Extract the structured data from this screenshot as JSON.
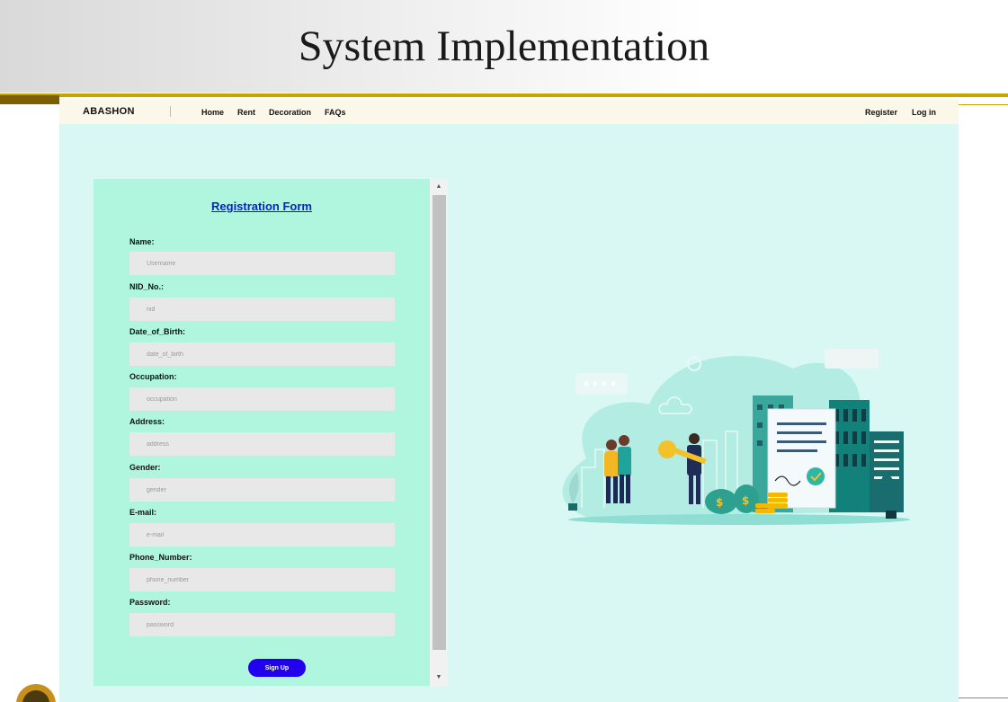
{
  "slide": {
    "title": "System Implementation"
  },
  "nav": {
    "brand": "ABASHON",
    "links": [
      "Home",
      "Rent",
      "Decoration",
      "FAQs"
    ],
    "right": [
      "Register",
      "Log in"
    ]
  },
  "form": {
    "title": "Registration Form",
    "fields": [
      {
        "label": "Name:",
        "placeholder": "Username"
      },
      {
        "label": "NID_No.:",
        "placeholder": "nid"
      },
      {
        "label": "Date_of_Birth:",
        "placeholder": "date_of_birth"
      },
      {
        "label": "Occupation:",
        "placeholder": "occupation"
      },
      {
        "label": "Address:",
        "placeholder": "address"
      },
      {
        "label": "Gender:",
        "placeholder": "gender"
      },
      {
        "label": "E-mail:",
        "placeholder": "e-mail"
      },
      {
        "label": "Phone_Number:",
        "placeholder": "phone_number"
      },
      {
        "label": "Password:",
        "placeholder": "password"
      }
    ],
    "submit": "Sign Up"
  },
  "colors": {
    "page_bg": "#d9f8f4",
    "form_bg": "#b0f5de",
    "button": "#2200ee",
    "title_link": "#0a22cc",
    "slide_rule": "#c8a400"
  },
  "icons": {
    "scroll_up": "scroll-up-arrow-icon",
    "scroll_down": "scroll-down-arrow-icon",
    "illustration": "real-estate-illustration",
    "logo": "university-seal-logo"
  }
}
